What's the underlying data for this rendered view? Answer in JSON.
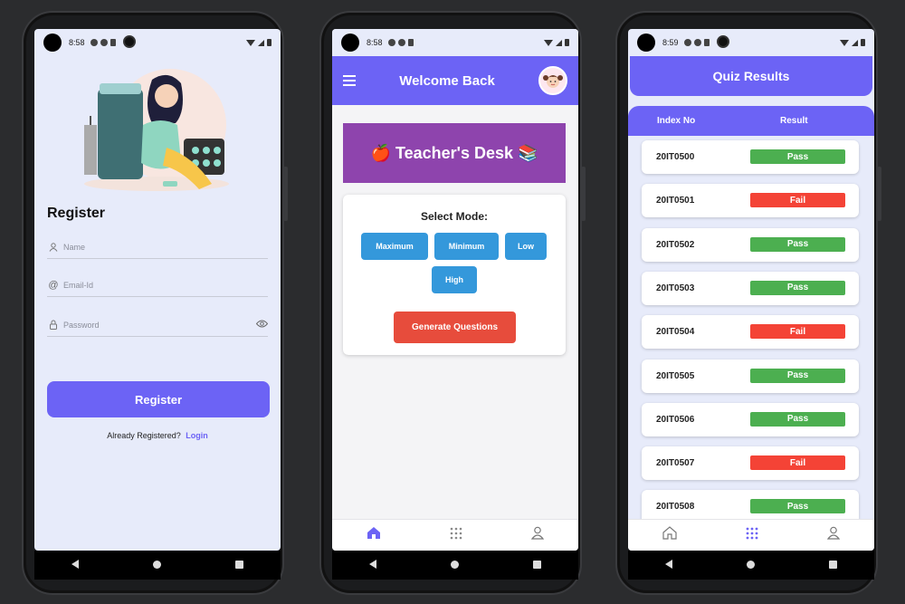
{
  "colors": {
    "primary": "#6c63f5",
    "pass": "#4caf50",
    "fail": "#f44336",
    "mode_button": "#3498db",
    "generate_button": "#e74c3c",
    "banner": "#8e44ad"
  },
  "register_screen": {
    "status_time": "8:58",
    "title": "Register",
    "name_placeholder": "Name",
    "email_placeholder": "Email-Id",
    "password_placeholder": "Password",
    "register_button": "Register",
    "already_registered": "Already Registered?",
    "login_link": "Login"
  },
  "teacher_screen": {
    "status_time": "8:58",
    "app_title": "Welcome Back",
    "banner_title": "🍎 Teacher's Desk 📚",
    "select_mode": "Select Mode:",
    "modes": [
      "Maximum",
      "Minimum",
      "Low",
      "High"
    ],
    "generate_button": "Generate Questions",
    "bottom_nav": [
      "home-icon",
      "apps-icon",
      "profile-icon"
    ],
    "active_tab": "home"
  },
  "quiz_screen": {
    "status_time": "8:59",
    "title": "Quiz Results",
    "columns": [
      "Index No",
      "Result"
    ],
    "results": [
      {
        "index": "20IT0500",
        "result": "Pass"
      },
      {
        "index": "20IT0501",
        "result": "Fail"
      },
      {
        "index": "20IT0502",
        "result": "Pass"
      },
      {
        "index": "20IT0503",
        "result": "Pass"
      },
      {
        "index": "20IT0504",
        "result": "Fail"
      },
      {
        "index": "20IT0505",
        "result": "Pass"
      },
      {
        "index": "20IT0506",
        "result": "Pass"
      },
      {
        "index": "20IT0507",
        "result": "Fail"
      },
      {
        "index": "20IT0508",
        "result": "Pass"
      }
    ],
    "bottom_nav": [
      "home-icon",
      "apps-icon",
      "profile-icon"
    ],
    "active_tab": "apps"
  }
}
